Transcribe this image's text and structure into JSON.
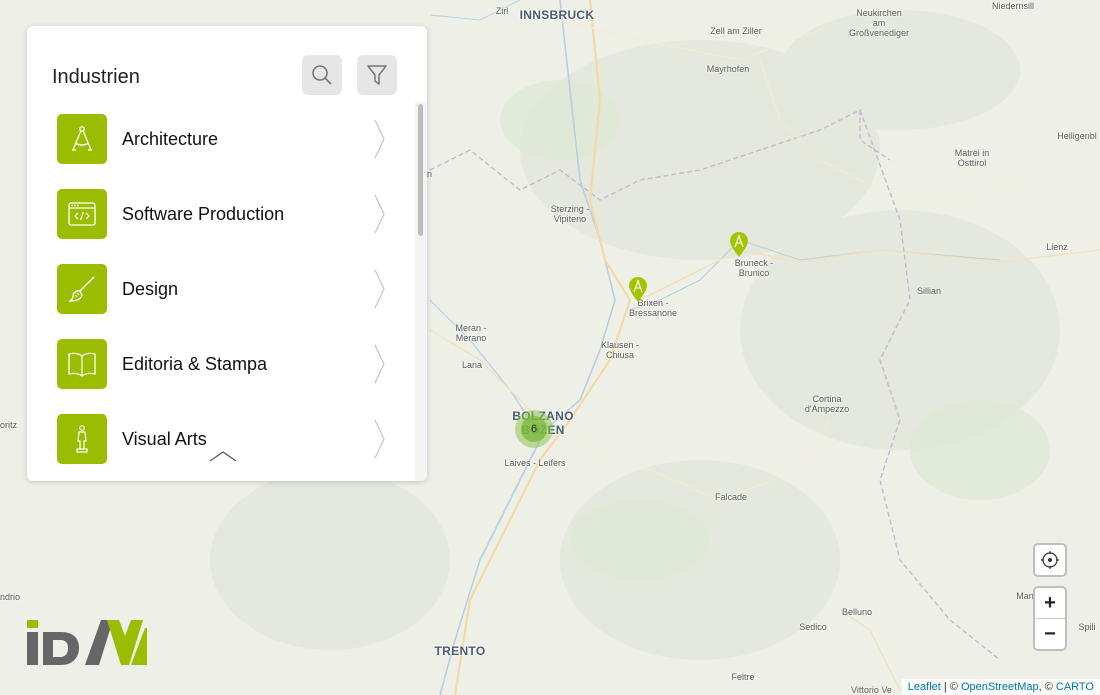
{
  "panel": {
    "title": "Industrien",
    "search_icon": "search-icon",
    "filter_icon": "filter-icon",
    "items": [
      {
        "label": "Architecture",
        "icon": "compass-icon"
      },
      {
        "label": "Software Production",
        "icon": "code-window-icon"
      },
      {
        "label": "Design",
        "icon": "brush-icon"
      },
      {
        "label": "Editoria & Stampa",
        "icon": "open-book-icon"
      },
      {
        "label": "Visual Arts",
        "icon": "statue-icon"
      }
    ]
  },
  "map": {
    "places": [
      {
        "id": "zirl",
        "text": "Zirl"
      },
      {
        "id": "innsbruck",
        "text": "INNSBRUCK"
      },
      {
        "id": "zell",
        "text": "Zell am Ziller"
      },
      {
        "id": "neukirchen",
        "text": "Neukirchen\nam\nGroßvenediger"
      },
      {
        "id": "niedernsill",
        "text": "Niedernsill"
      },
      {
        "id": "mayrhofen",
        "text": "Mayrhofen"
      },
      {
        "id": "heiligenblut",
        "text": "Heiligenbl"
      },
      {
        "id": "matrei",
        "text": "Matrei in\nOsttirol"
      },
      {
        "id": "sterzing",
        "text": "Sterzing -\nVipiteno"
      },
      {
        "id": "bruneck",
        "text": "Bruneck -\nBrunico"
      },
      {
        "id": "lienz",
        "text": "Lienz"
      },
      {
        "id": "sillian",
        "text": "Sillian"
      },
      {
        "id": "brixen",
        "text": "Brixen -\nBressanone"
      },
      {
        "id": "meran",
        "text": "Meran -\nMerano"
      },
      {
        "id": "klausen",
        "text": "Klausen -\nChiusa"
      },
      {
        "id": "lana",
        "text": "Lana"
      },
      {
        "id": "bolzano",
        "text": "BOLZANO\nBOZEN"
      },
      {
        "id": "cortina",
        "text": "Cortina\nd'Ampezzo"
      },
      {
        "id": "laives",
        "text": "Laives - Leifers"
      },
      {
        "id": "falcade",
        "text": "Falcade"
      },
      {
        "id": "oritz",
        "text": "oritz"
      },
      {
        "id": "ndrio",
        "text": "ndrio"
      },
      {
        "id": "trento",
        "text": "TRENTO"
      },
      {
        "id": "belluno",
        "text": "Belluno"
      },
      {
        "id": "sedico",
        "text": "Sedico"
      },
      {
        "id": "feltre",
        "text": "Feltre"
      },
      {
        "id": "vittorio",
        "text": "Vittorio Ve"
      },
      {
        "id": "man",
        "text": "Man"
      },
      {
        "id": "spili",
        "text": "Spili"
      },
      {
        "id": "partial_n",
        "text": "n"
      }
    ],
    "cluster": {
      "count": "6"
    },
    "markers": [
      {
        "name": "marker-brixen",
        "icon": "compass-icon"
      },
      {
        "name": "marker-bruneck",
        "icon": "compass-icon"
      }
    ]
  },
  "controls": {
    "locate_icon": "locate-icon",
    "zoom_in": "+",
    "zoom_out": "−"
  },
  "attribution": {
    "leaflet": "Leaflet",
    "sep1": " | © ",
    "osm": "OpenStreetMap",
    "sep2": ", © ",
    "carto": "CARTO"
  },
  "logo": {
    "text": "IDM"
  },
  "colors": {
    "accent": "#9abd00",
    "cluster": "#7ab838",
    "marker": "#a4c400"
  }
}
